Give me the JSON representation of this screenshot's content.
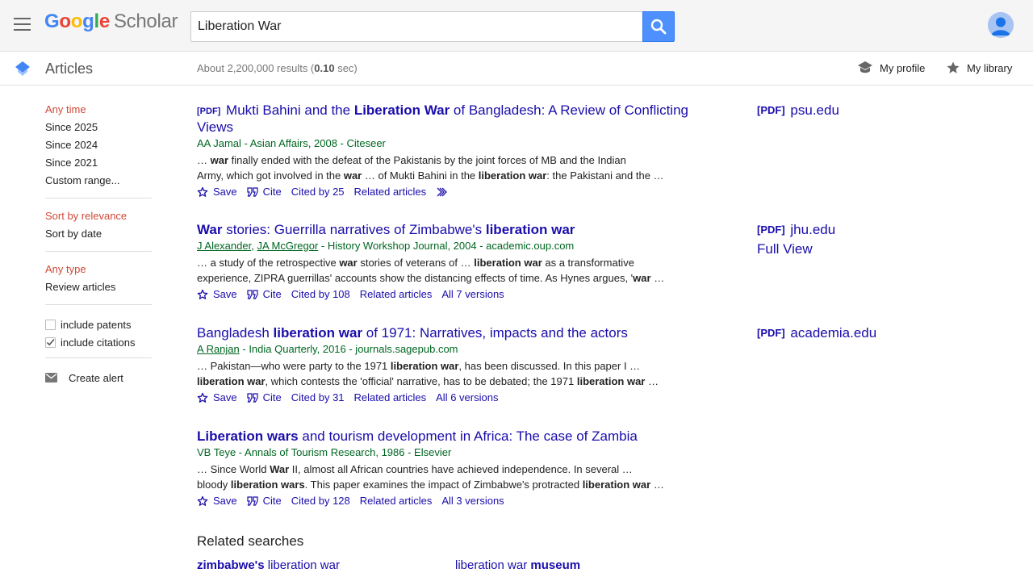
{
  "header": {
    "logo": {
      "letters": [
        {
          "char": "G",
          "color": "#4285F4"
        },
        {
          "char": "o",
          "color": "#EA4335"
        },
        {
          "char": "o",
          "color": "#FBBC05"
        },
        {
          "char": "g",
          "color": "#4285F4"
        },
        {
          "char": "l",
          "color": "#34A853"
        },
        {
          "char": "e",
          "color": "#EA4335"
        }
      ],
      "suffix": "Scholar"
    },
    "search_value": "Liberation War",
    "search_icon": "search-icon",
    "menu_icon": "menu-icon",
    "avatar_icon": "account-icon"
  },
  "subbar": {
    "section_title": "Articles",
    "results_prefix": "About 2,200,000 results (",
    "results_time": "0.10",
    "results_suffix": " sec)",
    "my_profile": "My profile",
    "my_library": "My library"
  },
  "sidebar": {
    "time_filters": [
      "Any time",
      "Since 2025",
      "Since 2024",
      "Since 2021",
      "Custom range..."
    ],
    "sort_options": [
      "Sort by relevance",
      "Sort by date"
    ],
    "type_filters": [
      "Any type",
      "Review articles"
    ],
    "include_patents": "include patents",
    "include_citations": "include citations",
    "patents_checked": false,
    "citations_checked": true,
    "create_alert": "Create alert"
  },
  "actions": {
    "save": "Save",
    "cite": "Cite"
  },
  "results": [
    {
      "tag": "[PDF]",
      "title_html": "Mukti Bahini and the <b>Liberation War</b> of Bangladesh: A Review of Conflicting Views",
      "authors": [
        {
          "name": "AA Jamal",
          "linked": false
        }
      ],
      "meta_rest": " - Asian Affairs, 2008 - Citeseer",
      "snippet1": "… <b>war</b> finally ended with the defeat of the Pakistanis by the joint forces of MB and the Indian",
      "snippet2": "Army, which got involved in the <b>war</b> … of Mukti Bahini in the <b>liberation war</b>: the Pakistani and the …",
      "cited_by": "Cited by 25",
      "related": "Related articles",
      "versions": "",
      "more_icon": true,
      "side": {
        "tag": "[PDF]",
        "label": "psu.edu",
        "extra": ""
      }
    },
    {
      "tag": "",
      "title_html": "<b>War</b> stories: Guerrilla narratives of Zimbabwe's <b>liberation war</b>",
      "authors": [
        {
          "name": "J Alexander",
          "linked": true
        },
        {
          "name": "JA McGregor",
          "linked": true
        }
      ],
      "meta_rest": " - History Workshop Journal, 2004 - academic.oup.com",
      "snippet1": "… a study of the retrospective <b>war</b> stories of veterans of … <b>liberation war</b> as a transformative",
      "snippet2": "experience, ZIPRA guerrillas' accounts show the distancing effects of time. As Hynes argues, '<b>war</b> …",
      "cited_by": "Cited by 108",
      "related": "Related articles",
      "versions": "All 7 versions",
      "more_icon": false,
      "side": {
        "tag": "[PDF]",
        "label": "jhu.edu",
        "extra": "Full View"
      }
    },
    {
      "tag": "",
      "title_html": "Bangladesh <b>liberation war</b> of 1971: Narratives, impacts and the actors",
      "authors": [
        {
          "name": "A Ranjan",
          "linked": true
        }
      ],
      "meta_rest": " - India Quarterly, 2016 - journals.sagepub.com",
      "snippet1": "… Pakistan—who were party to the 1971 <b>liberation war</b>, has been discussed. In this paper I …",
      "snippet2": "<b>liberation war</b>, which contests the 'official' narrative, has to be debated; the 1971 <b>liberation war</b> …",
      "cited_by": "Cited by 31",
      "related": "Related articles",
      "versions": "All 6 versions",
      "more_icon": false,
      "side": {
        "tag": "[PDF]",
        "label": "academia.edu",
        "extra": ""
      }
    },
    {
      "tag": "",
      "title_html": "<b>Liberation wars</b> and tourism development in Africa: The case of Zambia",
      "authors": [
        {
          "name": "VB Teye",
          "linked": false
        }
      ],
      "meta_rest": " - Annals of Tourism Research, 1986 - Elsevier",
      "snippet1": "… Since World <b>War</b> II, almost all African countries have achieved independence. In several …",
      "snippet2": "bloody <b>liberation wars</b>. This paper examines the impact of Zimbabwe's protracted <b>liberation war</b> …",
      "cited_by": "Cited by 128",
      "related": "Related articles",
      "versions": "All 3 versions",
      "more_icon": false,
      "side": null
    }
  ],
  "related_searches": {
    "title": "Related searches",
    "items": [
      {
        "html": "<b>zimbabwe's</b> liberation war"
      },
      {
        "html": "liberation war <b>museum</b>"
      }
    ]
  }
}
